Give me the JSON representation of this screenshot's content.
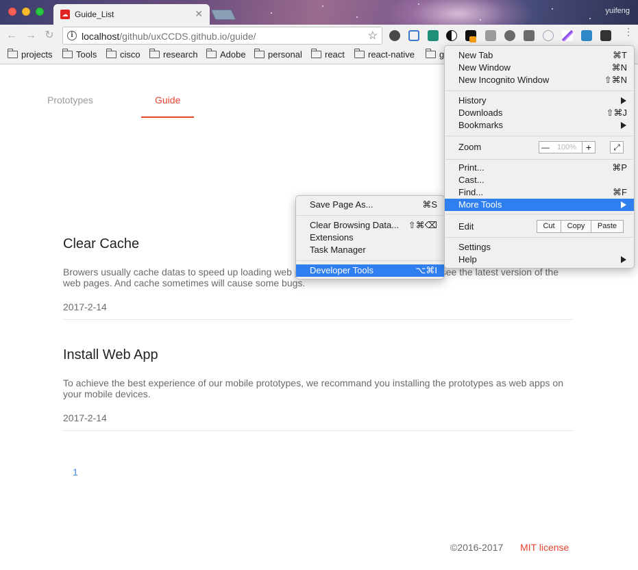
{
  "browser": {
    "tab_title": "Guide_List",
    "tab_close": "✕",
    "profile_name": "yuifeng",
    "url_host": "localhost",
    "url_path": "/github/uxCCDS.github.io/guide/"
  },
  "bookmarks": [
    "projects",
    "Tools",
    "cisco",
    "research",
    "Adobe",
    "personal",
    "react",
    "react-native",
    "g"
  ],
  "page": {
    "nav": {
      "prototypes": "Prototypes",
      "guide": "Guide"
    },
    "articles": [
      {
        "title": "Clear Cache",
        "body": "Browers usually cache datas to speed up loading web pages. But sometimes we can not see the latest version of the web pages. And cache sometimes will cause some bugs.",
        "date": "2017-2-14"
      },
      {
        "title": "Install Web App",
        "body": "To achieve the best experience of our mobile prototypes, we recommand you installing the prototypes as web apps on your mobile devices.",
        "date": "2017-2-14"
      }
    ],
    "pagination": "1",
    "copyright": "©2016-2017",
    "license": "MIT license"
  },
  "chrome_menu": {
    "new_tab": {
      "label": "New Tab",
      "shortcut": "⌘T"
    },
    "new_window": {
      "label": "New Window",
      "shortcut": "⌘N"
    },
    "new_incognito": {
      "label": "New Incognito Window",
      "shortcut": "⇧⌘N"
    },
    "history": {
      "label": "History"
    },
    "downloads": {
      "label": "Downloads",
      "shortcut": "⇧⌘J"
    },
    "bookmarks": {
      "label": "Bookmarks"
    },
    "zoom": {
      "label": "Zoom",
      "minus": "—",
      "value": "100%",
      "plus": "+",
      "fullscreen": "⤢"
    },
    "print": {
      "label": "Print...",
      "shortcut": "⌘P"
    },
    "cast": {
      "label": "Cast..."
    },
    "find": {
      "label": "Find...",
      "shortcut": "⌘F"
    },
    "more_tools": {
      "label": "More Tools"
    },
    "edit": {
      "label": "Edit",
      "cut": "Cut",
      "copy": "Copy",
      "paste": "Paste"
    },
    "settings": {
      "label": "Settings"
    },
    "help": {
      "label": "Help"
    }
  },
  "more_tools_menu": {
    "save_page": {
      "label": "Save Page As...",
      "shortcut": "⌘S"
    },
    "clear_browsing": {
      "label": "Clear Browsing Data...",
      "shortcut": "⇧⌘⌫"
    },
    "extensions": {
      "label": "Extensions"
    },
    "task_manager": {
      "label": "Task Manager"
    },
    "developer_tools": {
      "label": "Developer Tools",
      "shortcut": "⌥⌘I"
    }
  },
  "colors": {
    "accent": "#e8432f",
    "link": "#3c8ae6",
    "menu_highlight": "#2f7ff0"
  },
  "icons": [
    "back-arrow-icon",
    "forward-arrow-icon",
    "reload-icon",
    "info-icon",
    "bookmark-star-icon",
    "folder-icon",
    "chrome-menu-icon",
    "submenu-arrow-icon"
  ]
}
